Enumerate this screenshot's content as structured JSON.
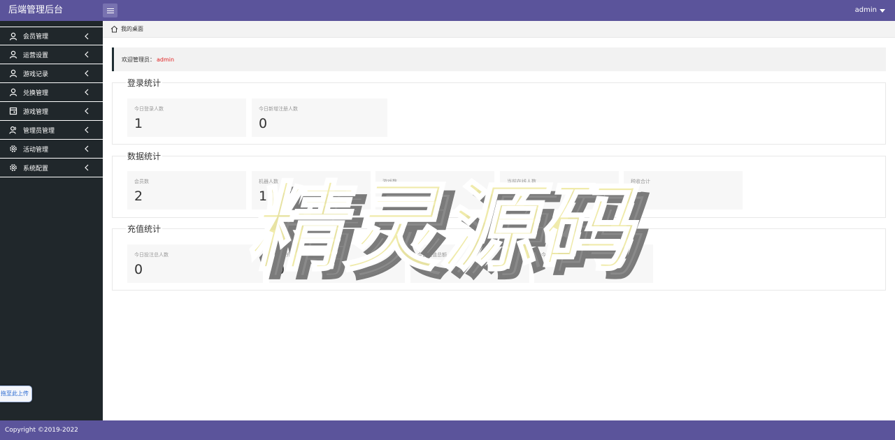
{
  "header": {
    "brand": "后端管理后台",
    "user": "admin"
  },
  "sidebar": {
    "items": [
      {
        "label": "会员管理",
        "icon": "user-icon"
      },
      {
        "label": "运营设置",
        "icon": "user-icon"
      },
      {
        "label": "游戏记录",
        "icon": "user-icon"
      },
      {
        "label": "兑换管理",
        "icon": "user-icon"
      },
      {
        "label": "游戏管理",
        "icon": "calendar-icon"
      },
      {
        "label": "管理员管理",
        "icon": "user-group-icon"
      },
      {
        "label": "活动管理",
        "icon": "gear-icon"
      },
      {
        "label": "系统配置",
        "icon": "gear-icon"
      }
    ],
    "upload_label": "拖至此上传"
  },
  "breadcrumb": {
    "label": "我的桌面",
    "icon": "home-icon"
  },
  "welcome": {
    "prefix": "欢迎管理员：",
    "name": "admin"
  },
  "sections": {
    "login": {
      "title": "登录统计",
      "cards": [
        {
          "label": "今日登录人数",
          "value": "1"
        },
        {
          "label": "今日新增注册人数",
          "value": "0"
        }
      ]
    },
    "data": {
      "title": "数据统计",
      "cards": [
        {
          "label": "会员数",
          "value": "2"
        },
        {
          "label": "机器人数",
          "value": "10487"
        },
        {
          "label": "游戏数",
          "value": "31"
        },
        {
          "label": "当前在线人数",
          "value": "0"
        },
        {
          "label": "税收合计",
          "value": "0"
        }
      ]
    },
    "recharge": {
      "title": "充值统计",
      "cards": [
        {
          "label": "今日投注总人数",
          "value": "0"
        },
        {
          "label": "今日充值人数",
          "value": "0"
        },
        {
          "label": "今日充值总额",
          "value": ""
        },
        {
          "label": "今日提现总额",
          "value": ""
        }
      ]
    }
  },
  "watermark": {
    "text": "精灵源码"
  },
  "footer": {
    "copyright": "Copyright ©2019-2022"
  },
  "colors": {
    "header_bg": "#5b549b",
    "sidebar_bg": "#20272b",
    "welcome_name": "#e02020"
  }
}
